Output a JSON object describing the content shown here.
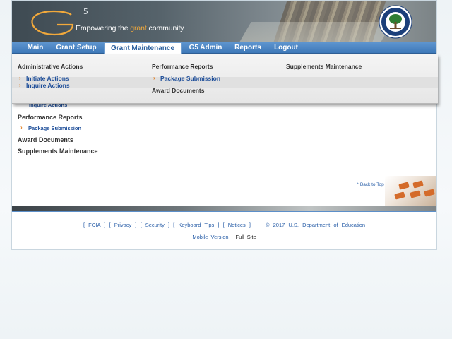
{
  "header": {
    "logo_letter": "G",
    "logo_sup": "5",
    "tagline_pre": "Empowering the ",
    "tagline_accent": "grant",
    "tagline_post": " community"
  },
  "nav": {
    "items": [
      {
        "label": "Main"
      },
      {
        "label": "Grant Setup"
      },
      {
        "label": "Grant Maintenance"
      },
      {
        "label": "G5 Admin"
      },
      {
        "label": "Reports"
      },
      {
        "label": "Logout"
      }
    ],
    "active_index": 2
  },
  "dropdown": {
    "col1": {
      "heading": "Administrative Actions",
      "links": [
        "Initiate Actions",
        "Inquire Actions"
      ]
    },
    "col2": {
      "heading": "Performance Reports",
      "links": [
        "Package Submission"
      ],
      "heading2": "Award Documents"
    },
    "col3": {
      "heading": "Supplements Maintenance"
    }
  },
  "content": {
    "peek_link": "Inquire Actions",
    "performance_heading": "Performance Reports",
    "package_link": "Package Submission",
    "award_heading": "Award Documents",
    "supplements_heading": "Supplements Maintenance",
    "back_to_top": "^ Back to Top"
  },
  "footer": {
    "links": [
      "FOIA",
      "Privacy",
      "Security",
      "Keyboard Tips",
      "Notices"
    ],
    "copyright": "© 2017 U.S. Department of Education",
    "mobile": "Mobile Version",
    "separator": "|",
    "full": "Full Site"
  },
  "colors": {
    "nav_blue": "#3d78b8",
    "link_blue": "#1f4f9a",
    "accent_orange": "#e07a1b"
  }
}
